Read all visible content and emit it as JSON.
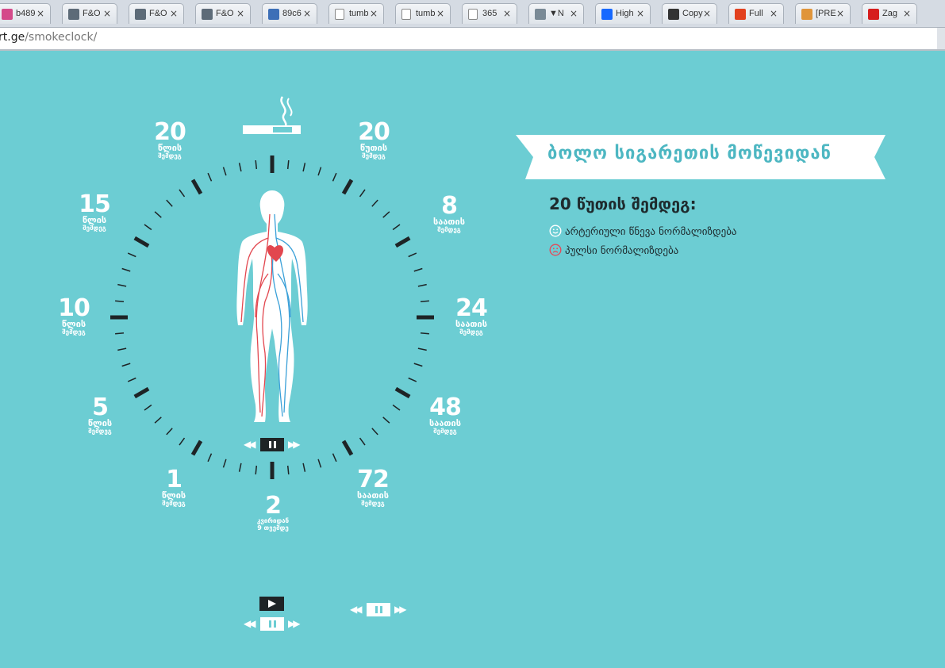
{
  "browser": {
    "tabs": [
      {
        "title": "b489",
        "icon": "heart-favicon",
        "color": "#d44a8a"
      },
      {
        "title": "F&O",
        "icon": "fo-favicon",
        "color": "#5d6b78"
      },
      {
        "title": "F&O",
        "icon": "fo-favicon",
        "color": "#5d6b78"
      },
      {
        "title": "F&O",
        "icon": "fo-favicon",
        "color": "#5d6b78"
      },
      {
        "title": "89c6",
        "icon": "b-favicon",
        "color": "#3d6fb7"
      },
      {
        "title": "tumb",
        "icon": "page-favicon",
        "color": "#ffffff"
      },
      {
        "title": "tumb",
        "icon": "page-favicon",
        "color": "#ffffff"
      },
      {
        "title": "365",
        "icon": "page-favicon",
        "color": "#ffffff"
      },
      {
        "title": "▼N",
        "icon": "figure-favicon",
        "color": "#7a8a96"
      },
      {
        "title": "High",
        "icon": "behance-favicon",
        "color": "#1769ff"
      },
      {
        "title": "Copy",
        "icon": "copy-favicon",
        "color": "#333333"
      },
      {
        "title": "Full",
        "icon": "u-favicon",
        "color": "#e2411f"
      },
      {
        "title": "[PRE",
        "icon": "cookie-favicon",
        "color": "#e0953a"
      },
      {
        "title": "Zag",
        "icon": "opera-favicon",
        "color": "#d61d1d"
      }
    ],
    "url_host": "rt.ge",
    "url_path": "/smokeclock/"
  },
  "banner": "ბოლო სიგარეთის მოწევიდან",
  "status": {
    "title": "20 წუთის შემდეგ:",
    "effects": [
      {
        "text": "არტერიული წნევა ნორმალიზდება",
        "icon": "smile-icon",
        "color": "#ffffff"
      },
      {
        "text": "პულსი ნორმალიზდება",
        "icon": "frown-icon",
        "color": "#e34a5a"
      }
    ]
  },
  "clock": {
    "labels": [
      {
        "num": "20",
        "unit": "წუთის",
        "sub": "შემდეგ"
      },
      {
        "num": "8",
        "unit": "საათის",
        "sub": "შემდეგ"
      },
      {
        "num": "24",
        "unit": "საათის",
        "sub": "შემდეგ"
      },
      {
        "num": "48",
        "unit": "საათის",
        "sub": "შემდეგ"
      },
      {
        "num": "72",
        "unit": "საათის",
        "sub": "შემდეგ"
      },
      {
        "num": "2",
        "unit": "კვირიდან",
        "sub": "9 თვემდე"
      },
      {
        "num": "1",
        "unit": "წლის",
        "sub": "შემდეგ"
      },
      {
        "num": "5",
        "unit": "წლის",
        "sub": "შემდეგ"
      },
      {
        "num": "10",
        "unit": "წლის",
        "sub": "შემდეგ"
      },
      {
        "num": "15",
        "unit": "წლის",
        "sub": "შემდეგ"
      },
      {
        "num": "20",
        "unit": "წლის",
        "sub": "შემდეგ"
      }
    ]
  },
  "colors": {
    "background": "#6ccdd3",
    "accent_text": "#4db7c2",
    "dark": "#1e2426",
    "artery": "#e2474f",
    "vein": "#3aa0d8"
  }
}
